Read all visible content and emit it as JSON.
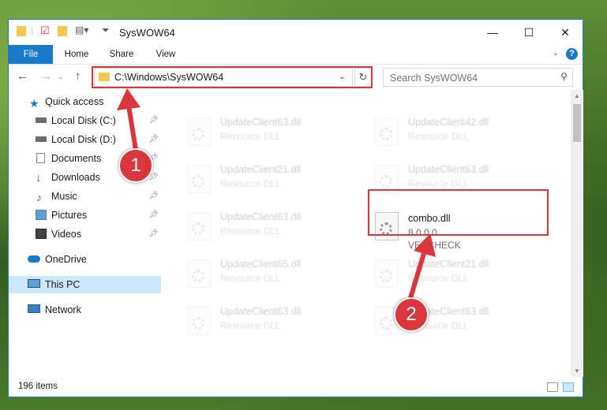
{
  "window": {
    "title": "SysWOW64",
    "controls": {
      "minimize": "—",
      "maximize": "☐",
      "close": "✕"
    }
  },
  "ribbon": {
    "tabs": [
      "File",
      "Home",
      "Share",
      "View"
    ],
    "help": "?"
  },
  "navigation": {
    "back": "←",
    "forward": "→",
    "up": "↑",
    "address_path": "C:\\Windows\\SysWOW64",
    "refresh": "↻",
    "search_placeholder": "Search SysWOW64"
  },
  "sidebar": {
    "items": [
      {
        "label": "Quick access",
        "icon": "star-icon"
      },
      {
        "label": "Local Disk (C:)",
        "icon": "drive-icon",
        "pinned": true
      },
      {
        "label": "Local Disk (D:)",
        "icon": "drive-icon",
        "pinned": true
      },
      {
        "label": "Documents",
        "icon": "documents-icon",
        "pinned": true
      },
      {
        "label": "Downloads",
        "icon": "download-icon",
        "pinned": true
      },
      {
        "label": "Music",
        "icon": "music-icon",
        "pinned": true
      },
      {
        "label": "Pictures",
        "icon": "pictures-icon",
        "pinned": true
      },
      {
        "label": "Videos",
        "icon": "videos-icon",
        "pinned": true
      },
      {
        "label": "OneDrive",
        "icon": "cloud-icon"
      },
      {
        "label": "This PC",
        "icon": "computer-icon",
        "selected": true
      },
      {
        "label": "Network",
        "icon": "network-icon"
      }
    ]
  },
  "files": [
    {
      "name": "UpdateClient63.dll",
      "sub": "Resource DLL"
    },
    {
      "name": "UpdateClient42.dll",
      "sub": "Resource DLL"
    },
    {
      "name": "UpdateClient21.dll",
      "sub": "Resource DLL"
    },
    {
      "name": "UpdateClient63.dll",
      "sub": "Resource DLL"
    },
    {
      "name": "UpdateClient63.dll",
      "sub": "Resource DLL"
    },
    {
      "name": "combo.dll",
      "sub": "8.0.0.0",
      "sub2": "VERCHECK"
    },
    {
      "name": "UpdateClient65.dll",
      "sub": "Resource DLL"
    },
    {
      "name": "UpdateClient21.dll",
      "sub": "Resource DLL"
    },
    {
      "name": "UpdateClient63.dll",
      "sub": "Resource DLL"
    },
    {
      "name": "UpdateClient63.dll",
      "sub": "Resource DLL"
    }
  ],
  "status": {
    "item_count": "196 items"
  },
  "annotations": {
    "step1": "1",
    "step2": "2",
    "color": "#d9363e"
  }
}
